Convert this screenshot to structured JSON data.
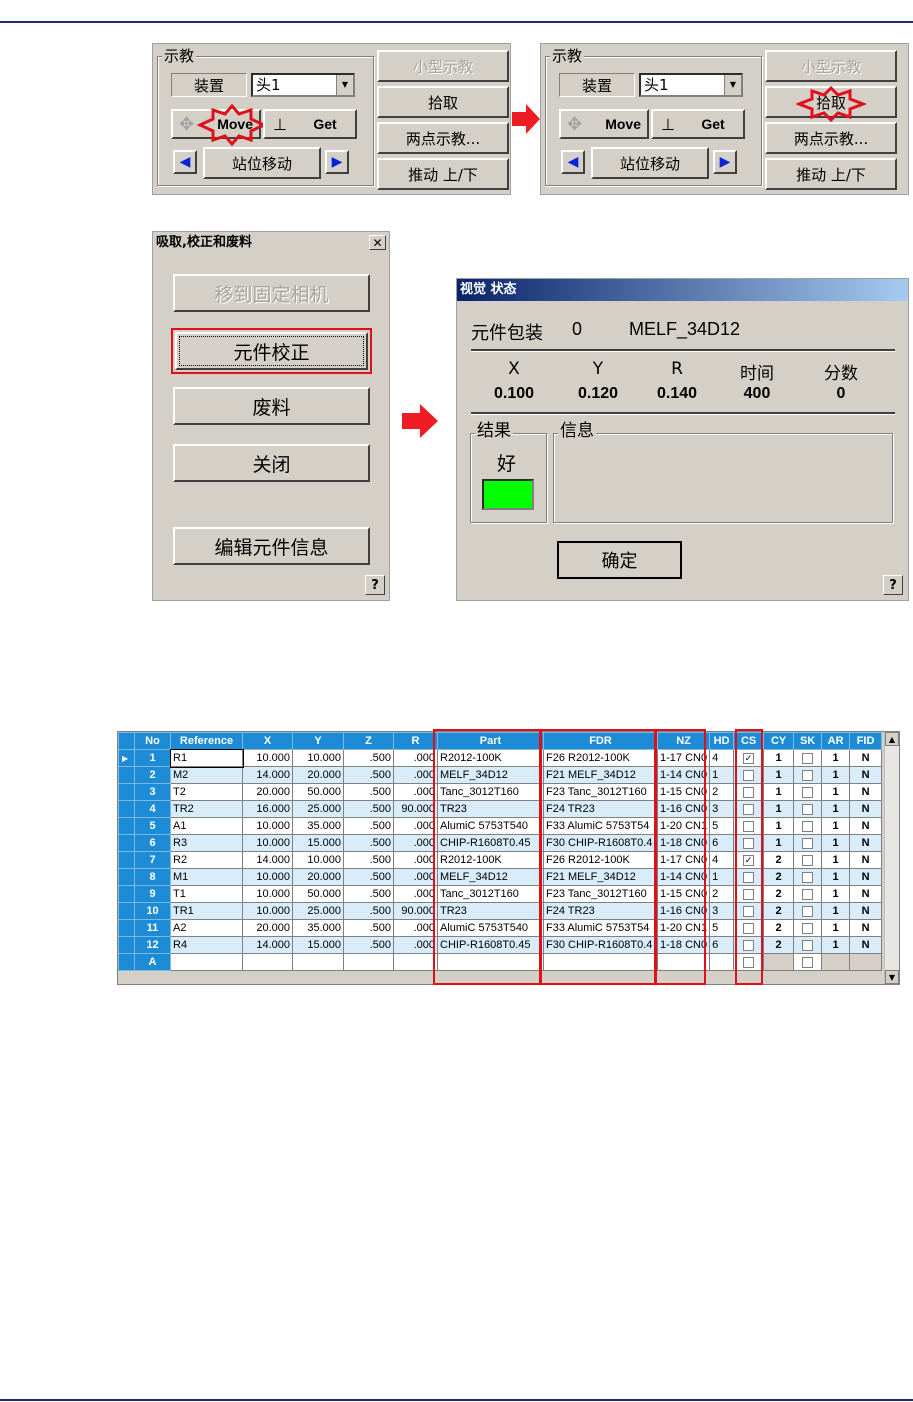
{
  "teach_panels": [
    {
      "group_label": "示教",
      "device_label": "装置",
      "device_value": "头1",
      "move_label": "Move",
      "get_label": "Get",
      "station_move_label": "站位移动",
      "small_teach_label": "小型示教",
      "pickup_label": "拾取",
      "two_point_label": "两点示教...",
      "push_label": "推动 上/下"
    },
    {
      "group_label": "示教",
      "device_label": "装置",
      "device_value": "头1",
      "move_label": "Move",
      "get_label": "Get",
      "station_move_label": "站位移动",
      "small_teach_label": "小型示教",
      "pickup_label": "拾取",
      "two_point_label": "两点示教...",
      "push_label": "推动 上/下"
    }
  ],
  "pick_dialog": {
    "title": "吸取,校正和废料",
    "close": "✕",
    "move_fixed_camera": "移到固定相机",
    "component_align": "元件校正",
    "scrap": "废料",
    "close_btn": "关闭",
    "edit_component": "编辑元件信息",
    "help": "?"
  },
  "vision_dialog": {
    "title": "视觉 状态",
    "package_label": "元件包装",
    "package_index": "0",
    "package_name": "MELF_34D12",
    "headers": [
      "X",
      "Y",
      "R",
      "时间",
      "分数"
    ],
    "values": [
      "0.100",
      "0.120",
      "0.140",
      "400",
      "0"
    ],
    "result_label": "结果",
    "result_value": "好",
    "result_color": "#00ff00",
    "info_label": "信息",
    "ok": "确定",
    "help": "?"
  },
  "grid": {
    "columns": [
      "No",
      "Reference",
      "X",
      "Y",
      "Z",
      "R",
      "Part",
      "FDR",
      "NZ",
      "HD",
      "CS",
      "CY",
      "SK",
      "AR",
      "FID"
    ],
    "rows": [
      {
        "no": "1",
        "ref": "R1",
        "x": "10.000",
        "y": "10.000",
        "z": ".500",
        "r": ".000",
        "part": "R2012-100K",
        "fdr": "F26 R2012-100K",
        "nz": "1-17 CN0",
        "hd": "4",
        "cs": true,
        "cy": "1",
        "sk": false,
        "ar": "1",
        "fid": "N"
      },
      {
        "no": "2",
        "ref": "M2",
        "x": "14.000",
        "y": "20.000",
        "z": ".500",
        "r": ".000",
        "part": "MELF_34D12",
        "fdr": "F21 MELF_34D12",
        "nz": "1-14 CN0",
        "hd": "1",
        "cs": false,
        "cy": "1",
        "sk": false,
        "ar": "1",
        "fid": "N"
      },
      {
        "no": "3",
        "ref": "T2",
        "x": "20.000",
        "y": "50.000",
        "z": ".500",
        "r": ".000",
        "part": "Tanc_3012T160",
        "fdr": "F23 Tanc_3012T160",
        "nz": "1-15 CN0",
        "hd": "2",
        "cs": false,
        "cy": "1",
        "sk": false,
        "ar": "1",
        "fid": "N"
      },
      {
        "no": "4",
        "ref": "TR2",
        "x": "16.000",
        "y": "25.000",
        "z": ".500",
        "r": "90.000",
        "part": "TR23",
        "fdr": "F24 TR23",
        "nz": "1-16 CN0",
        "hd": "3",
        "cs": false,
        "cy": "1",
        "sk": false,
        "ar": "1",
        "fid": "N"
      },
      {
        "no": "5",
        "ref": "A1",
        "x": "10.000",
        "y": "35.000",
        "z": ".500",
        "r": ".000",
        "part": "AlumiC 5753T540",
        "fdr": "F33 AlumiC 5753T54",
        "nz": "1-20 CN1",
        "hd": "5",
        "cs": false,
        "cy": "1",
        "sk": false,
        "ar": "1",
        "fid": "N"
      },
      {
        "no": "6",
        "ref": "R3",
        "x": "10.000",
        "y": "15.000",
        "z": ".500",
        "r": ".000",
        "part": "CHIP-R1608T0.45",
        "fdr": "F30 CHIP-R1608T0.4",
        "nz": "1-18 CN0",
        "hd": "6",
        "cs": false,
        "cy": "1",
        "sk": false,
        "ar": "1",
        "fid": "N"
      },
      {
        "no": "7",
        "ref": "R2",
        "x": "14.000",
        "y": "10.000",
        "z": ".500",
        "r": ".000",
        "part": "R2012-100K",
        "fdr": "F26 R2012-100K",
        "nz": "1-17 CN0",
        "hd": "4",
        "cs": true,
        "cy": "2",
        "sk": false,
        "ar": "1",
        "fid": "N"
      },
      {
        "no": "8",
        "ref": "M1",
        "x": "10.000",
        "y": "20.000",
        "z": ".500",
        "r": ".000",
        "part": "MELF_34D12",
        "fdr": "F21 MELF_34D12",
        "nz": "1-14 CN0",
        "hd": "1",
        "cs": false,
        "cy": "2",
        "sk": false,
        "ar": "1",
        "fid": "N"
      },
      {
        "no": "9",
        "ref": "T1",
        "x": "10.000",
        "y": "50.000",
        "z": ".500",
        "r": ".000",
        "part": "Tanc_3012T160",
        "fdr": "F23 Tanc_3012T160",
        "nz": "1-15 CN0",
        "hd": "2",
        "cs": false,
        "cy": "2",
        "sk": false,
        "ar": "1",
        "fid": "N"
      },
      {
        "no": "10",
        "ref": "TR1",
        "x": "10.000",
        "y": "25.000",
        "z": ".500",
        "r": "90.000",
        "part": "TR23",
        "fdr": "F24 TR23",
        "nz": "1-16 CN0",
        "hd": "3",
        "cs": false,
        "cy": "2",
        "sk": false,
        "ar": "1",
        "fid": "N"
      },
      {
        "no": "11",
        "ref": "A2",
        "x": "20.000",
        "y": "35.000",
        "z": ".500",
        "r": ".000",
        "part": "AlumiC 5753T540",
        "fdr": "F33 AlumiC 5753T54",
        "nz": "1-20 CN1",
        "hd": "5",
        "cs": false,
        "cy": "2",
        "sk": false,
        "ar": "1",
        "fid": "N"
      },
      {
        "no": "12",
        "ref": "R4",
        "x": "14.000",
        "y": "15.000",
        "z": ".500",
        "r": ".000",
        "part": "CHIP-R1608T0.45",
        "fdr": "F30 CHIP-R1608T0.4",
        "nz": "1-18 CN0",
        "hd": "6",
        "cs": false,
        "cy": "2",
        "sk": false,
        "ar": "1",
        "fid": "N"
      }
    ],
    "append_row_label": "A"
  }
}
